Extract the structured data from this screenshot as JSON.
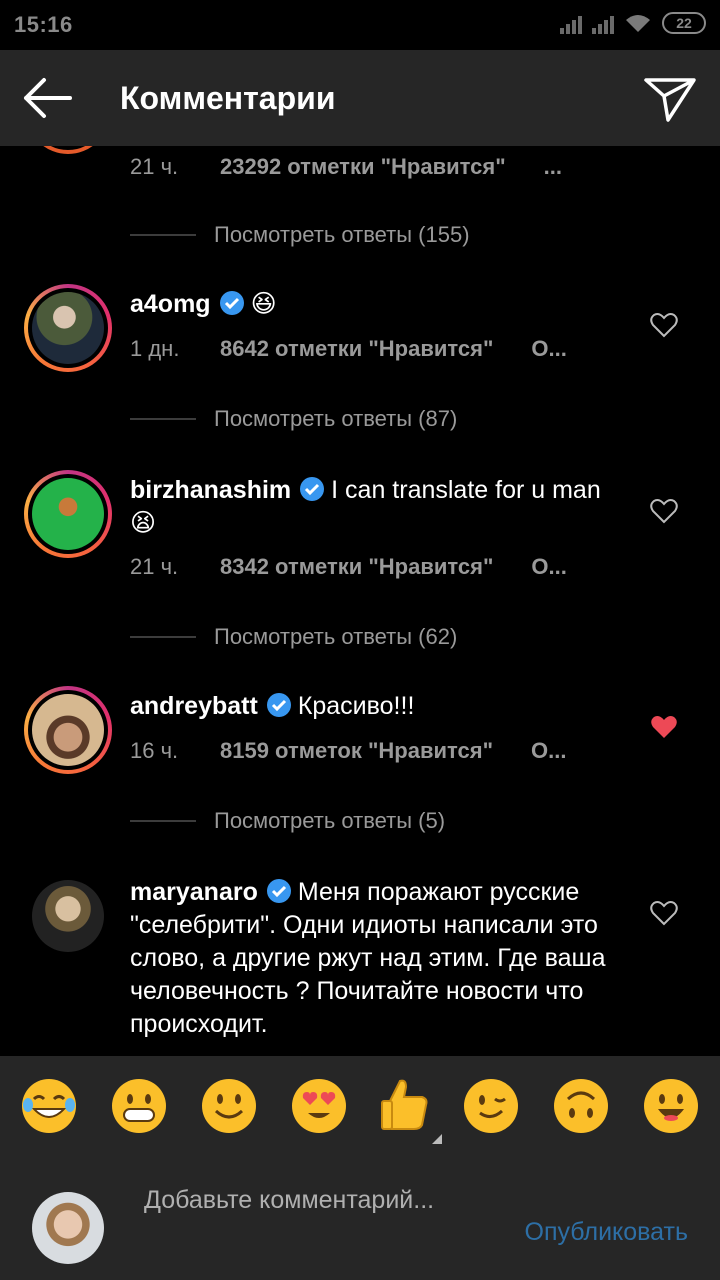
{
  "status_bar": {
    "time": "15:16",
    "battery": "22"
  },
  "header": {
    "title": "Комментарии",
    "back_icon": "arrow-left-icon",
    "send_icon": "paper-plane-icon"
  },
  "top_partial": {
    "time": "21 ч.",
    "likes": "23292 отметки \"Нравится\"",
    "more": "...",
    "view_replies": "Посмотреть ответы (155)"
  },
  "comments": [
    {
      "username": "a4omg",
      "verified": true,
      "text": "😆",
      "time": "1 дн.",
      "likes": "8642 отметки \"Нравится\"",
      "reply": "О...",
      "view_replies": "Посмотреть ответы (87)",
      "liked": false
    },
    {
      "username": "birzhanashim",
      "verified": true,
      "text": "I can translate for u man😫",
      "time": "21 ч.",
      "likes": "8342 отметки \"Нравится\"",
      "reply": "О...",
      "view_replies": "Посмотреть ответы (62)",
      "liked": false
    },
    {
      "username": "andreybatt",
      "verified": true,
      "text": "Красиво!!!",
      "time": "16 ч.",
      "likes": "8159 отметок \"Нравится\"",
      "reply": "О...",
      "view_replies": "Посмотреть ответы (5)",
      "liked": true
    },
    {
      "username": "maryanaro",
      "verified": true,
      "text": "Меня поражают русские \"селебрити\". Одни идиоты написали это слово, а другие ржут над этим. Где ваша человечность ? Почитайте новости что происходит.",
      "liked": false
    }
  ],
  "emoji_bar": [
    "grinning-tears-emoji",
    "grin-teeth-emoji",
    "smile-emoji",
    "heart-eyes-emoji",
    "thumbs-up-emoji",
    "wink-emoji",
    "upside-down-emoji",
    "open-smile-emoji"
  ],
  "compose": {
    "placeholder": "Добавьте комментарий...",
    "publish_label": "Опубликовать"
  },
  "colors": {
    "header_bg": "#262626",
    "muted": "#9a9a9a",
    "link_blue": "#2d6fa6",
    "like_red": "#ed4956",
    "verified_blue": "#3897f0"
  }
}
